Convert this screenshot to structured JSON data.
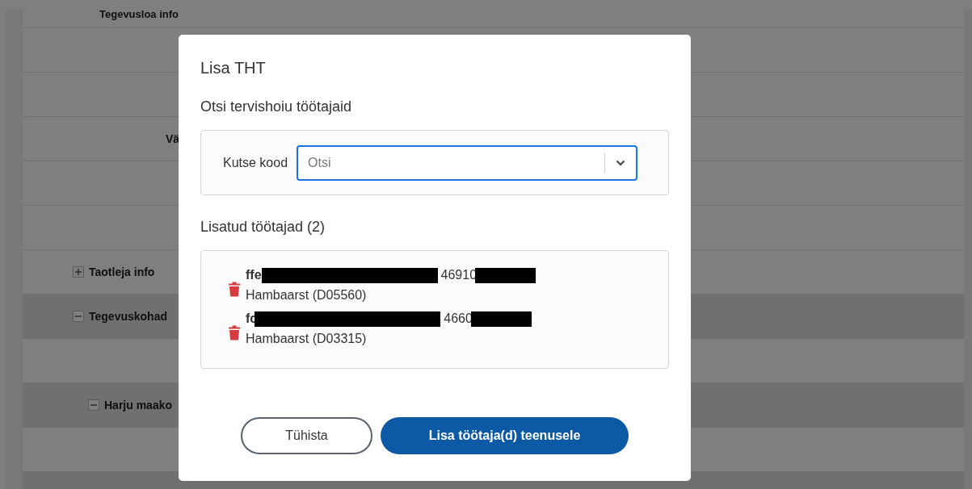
{
  "background": {
    "rows": [
      {
        "label": "Tegevusloa info",
        "expanded": false
      },
      {},
      {},
      {
        "field_label": "Vä"
      },
      {},
      {},
      {
        "label": "Taotleja info",
        "expanded": false
      },
      {
        "label": "Tegevuskohad",
        "expanded": true,
        "children": [
          {
            "expanded": false
          },
          {
            "label": "Harju maako",
            "expanded": true,
            "children": [
              {
                "expanded": false
              }
            ]
          }
        ]
      },
      {
        "expanded": true
      }
    ]
  },
  "dialog": {
    "title": "Lisa THT",
    "search_heading": "Otsi tervishoiu töötajaid",
    "search": {
      "label": "Kutse kood",
      "placeholder": "Otsi"
    },
    "added_heading": "Lisatud töötajad (2)",
    "employees": [
      {
        "name": "ffe",
        "code": "46910",
        "profession": "Hambaarst (D05560)"
      },
      {
        "name": "fc",
        "code": "4660",
        "profession": "Hambaarst (D03315)"
      }
    ],
    "buttons": [
      {
        "label": "Tühista",
        "kind": "secondary"
      },
      {
        "label": "Lisa töötaja(d) teenusele",
        "kind": "primary"
      }
    ]
  }
}
